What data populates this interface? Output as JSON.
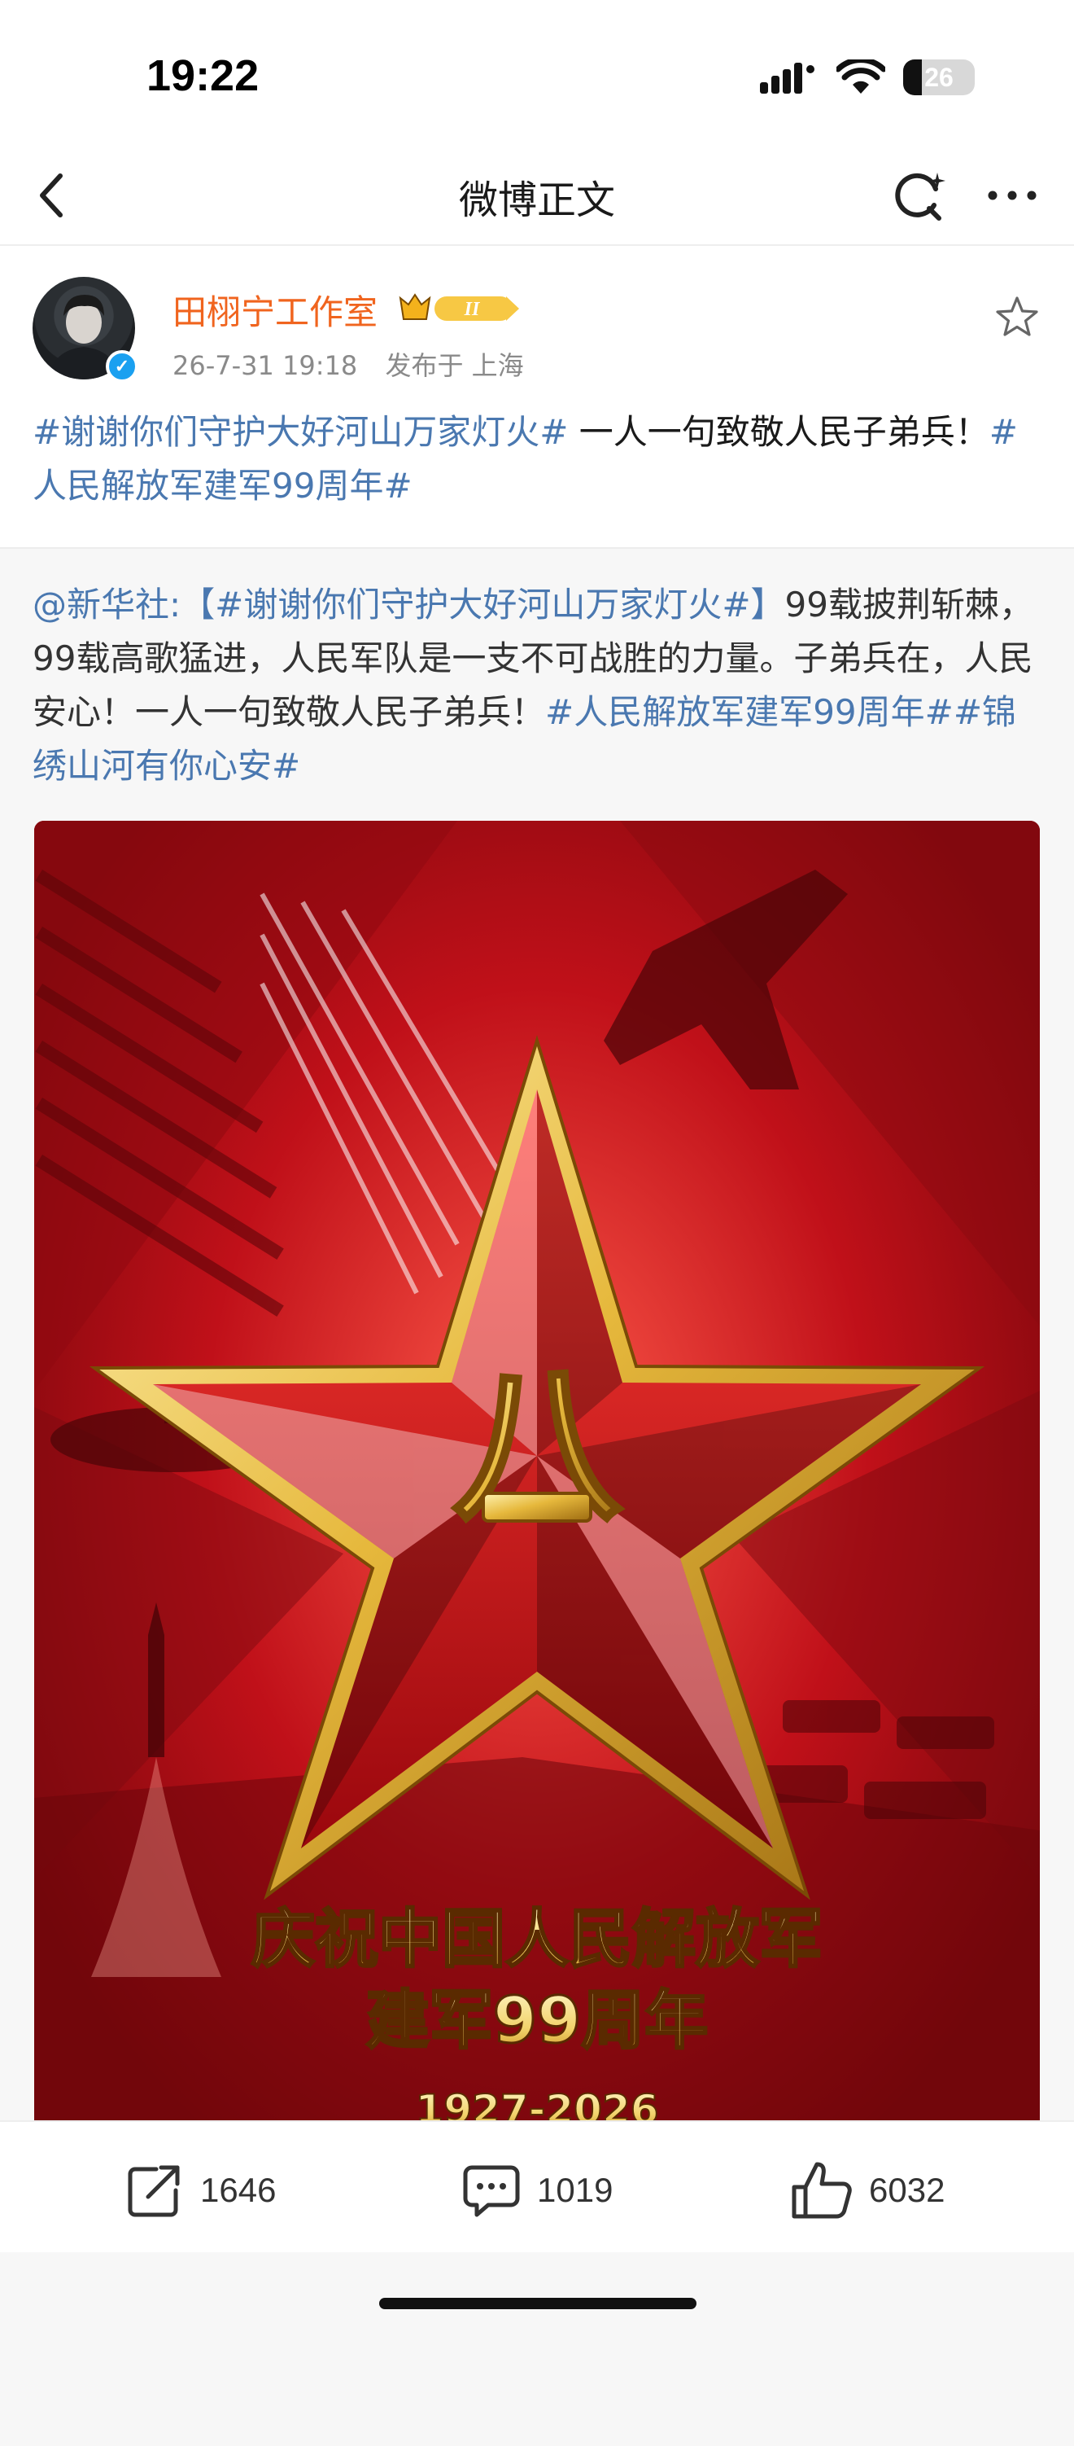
{
  "status": {
    "time": "19:22",
    "battery_text": "26",
    "battery_level": 0.26,
    "icons": [
      "cellular-signal-icon",
      "wifi-icon",
      "battery-icon"
    ]
  },
  "nav": {
    "title": "微博正文",
    "icons": [
      "back-arrow-icon",
      "refresh-icon",
      "more-icon"
    ]
  },
  "post": {
    "author": "田栩宁工作室",
    "badge_text": "II",
    "date": "26-7-31 19:18",
    "location": "发布于 上海",
    "text_parts": {
      "topic1": "#谢谢你们守护大好河山万家灯火#",
      "body": " 一人一句致敬人民子弟兵！",
      "topic2": "#人民解放军建军99周年#"
    }
  },
  "repost": {
    "mention": "@新华社:",
    "topic1": "【#谢谢你们守护大好河山万家灯火#】",
    "body": "99载披荆斩棘，99载高歌猛进，人民军队是一支不可战胜的力量。子弟兵在，人民安心！一人一句致敬人民子弟兵！",
    "topic2": "#人民解放军建军99周年#",
    "topic3": "#锦绣山河有你心安#"
  },
  "poster": {
    "star_glyph": "八",
    "line1": "庆祝中国人民解放军",
    "line2": "建军99周年",
    "years": "1927-2026"
  },
  "actions": {
    "repost_count": "1646",
    "comment_count": "1019",
    "like_count": "6032"
  },
  "colors": {
    "topic": "#4a78b0",
    "author": "#f0641e",
    "poster_red": "#c3131c",
    "poster_gold": "#f2d36b"
  }
}
